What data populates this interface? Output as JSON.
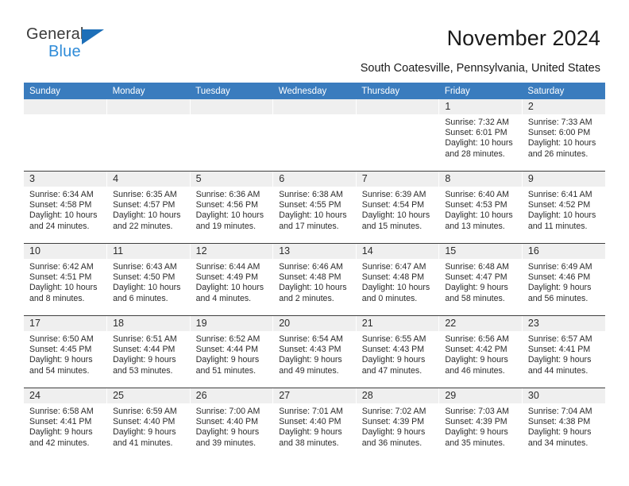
{
  "brand": {
    "name_part1": "General",
    "name_part2": "Blue",
    "logo_icon": "blue-triangle-icon",
    "accent_color": "#2e8bd8",
    "header_color": "#3a7cbe"
  },
  "header": {
    "title": "November 2024",
    "subtitle": "South Coatesville, Pennsylvania, United States"
  },
  "calendar": {
    "weekday_headers": [
      "Sunday",
      "Monday",
      "Tuesday",
      "Wednesday",
      "Thursday",
      "Friday",
      "Saturday"
    ],
    "labels": {
      "sunrise": "Sunrise:",
      "sunset": "Sunset:",
      "daylight": "Daylight:"
    },
    "weeks": [
      [
        {
          "day": "",
          "empty": true
        },
        {
          "day": "",
          "empty": true
        },
        {
          "day": "",
          "empty": true
        },
        {
          "day": "",
          "empty": true
        },
        {
          "day": "",
          "empty": true
        },
        {
          "day": "1",
          "sunrise": "Sunrise: 7:32 AM",
          "sunset": "Sunset: 6:01 PM",
          "daylight_line1": "Daylight: 10 hours",
          "daylight_line2": "and 28 minutes."
        },
        {
          "day": "2",
          "sunrise": "Sunrise: 7:33 AM",
          "sunset": "Sunset: 6:00 PM",
          "daylight_line1": "Daylight: 10 hours",
          "daylight_line2": "and 26 minutes."
        }
      ],
      [
        {
          "day": "3",
          "sunrise": "Sunrise: 6:34 AM",
          "sunset": "Sunset: 4:58 PM",
          "daylight_line1": "Daylight: 10 hours",
          "daylight_line2": "and 24 minutes."
        },
        {
          "day": "4",
          "sunrise": "Sunrise: 6:35 AM",
          "sunset": "Sunset: 4:57 PM",
          "daylight_line1": "Daylight: 10 hours",
          "daylight_line2": "and 22 minutes."
        },
        {
          "day": "5",
          "sunrise": "Sunrise: 6:36 AM",
          "sunset": "Sunset: 4:56 PM",
          "daylight_line1": "Daylight: 10 hours",
          "daylight_line2": "and 19 minutes."
        },
        {
          "day": "6",
          "sunrise": "Sunrise: 6:38 AM",
          "sunset": "Sunset: 4:55 PM",
          "daylight_line1": "Daylight: 10 hours",
          "daylight_line2": "and 17 minutes."
        },
        {
          "day": "7",
          "sunrise": "Sunrise: 6:39 AM",
          "sunset": "Sunset: 4:54 PM",
          "daylight_line1": "Daylight: 10 hours",
          "daylight_line2": "and 15 minutes."
        },
        {
          "day": "8",
          "sunrise": "Sunrise: 6:40 AM",
          "sunset": "Sunset: 4:53 PM",
          "daylight_line1": "Daylight: 10 hours",
          "daylight_line2": "and 13 minutes."
        },
        {
          "day": "9",
          "sunrise": "Sunrise: 6:41 AM",
          "sunset": "Sunset: 4:52 PM",
          "daylight_line1": "Daylight: 10 hours",
          "daylight_line2": "and 11 minutes."
        }
      ],
      [
        {
          "day": "10",
          "sunrise": "Sunrise: 6:42 AM",
          "sunset": "Sunset: 4:51 PM",
          "daylight_line1": "Daylight: 10 hours",
          "daylight_line2": "and 8 minutes."
        },
        {
          "day": "11",
          "sunrise": "Sunrise: 6:43 AM",
          "sunset": "Sunset: 4:50 PM",
          "daylight_line1": "Daylight: 10 hours",
          "daylight_line2": "and 6 minutes."
        },
        {
          "day": "12",
          "sunrise": "Sunrise: 6:44 AM",
          "sunset": "Sunset: 4:49 PM",
          "daylight_line1": "Daylight: 10 hours",
          "daylight_line2": "and 4 minutes."
        },
        {
          "day": "13",
          "sunrise": "Sunrise: 6:46 AM",
          "sunset": "Sunset: 4:48 PM",
          "daylight_line1": "Daylight: 10 hours",
          "daylight_line2": "and 2 minutes."
        },
        {
          "day": "14",
          "sunrise": "Sunrise: 6:47 AM",
          "sunset": "Sunset: 4:48 PM",
          "daylight_line1": "Daylight: 10 hours",
          "daylight_line2": "and 0 minutes."
        },
        {
          "day": "15",
          "sunrise": "Sunrise: 6:48 AM",
          "sunset": "Sunset: 4:47 PM",
          "daylight_line1": "Daylight: 9 hours",
          "daylight_line2": "and 58 minutes."
        },
        {
          "day": "16",
          "sunrise": "Sunrise: 6:49 AM",
          "sunset": "Sunset: 4:46 PM",
          "daylight_line1": "Daylight: 9 hours",
          "daylight_line2": "and 56 minutes."
        }
      ],
      [
        {
          "day": "17",
          "sunrise": "Sunrise: 6:50 AM",
          "sunset": "Sunset: 4:45 PM",
          "daylight_line1": "Daylight: 9 hours",
          "daylight_line2": "and 54 minutes."
        },
        {
          "day": "18",
          "sunrise": "Sunrise: 6:51 AM",
          "sunset": "Sunset: 4:44 PM",
          "daylight_line1": "Daylight: 9 hours",
          "daylight_line2": "and 53 minutes."
        },
        {
          "day": "19",
          "sunrise": "Sunrise: 6:52 AM",
          "sunset": "Sunset: 4:44 PM",
          "daylight_line1": "Daylight: 9 hours",
          "daylight_line2": "and 51 minutes."
        },
        {
          "day": "20",
          "sunrise": "Sunrise: 6:54 AM",
          "sunset": "Sunset: 4:43 PM",
          "daylight_line1": "Daylight: 9 hours",
          "daylight_line2": "and 49 minutes."
        },
        {
          "day": "21",
          "sunrise": "Sunrise: 6:55 AM",
          "sunset": "Sunset: 4:43 PM",
          "daylight_line1": "Daylight: 9 hours",
          "daylight_line2": "and 47 minutes."
        },
        {
          "day": "22",
          "sunrise": "Sunrise: 6:56 AM",
          "sunset": "Sunset: 4:42 PM",
          "daylight_line1": "Daylight: 9 hours",
          "daylight_line2": "and 46 minutes."
        },
        {
          "day": "23",
          "sunrise": "Sunrise: 6:57 AM",
          "sunset": "Sunset: 4:41 PM",
          "daylight_line1": "Daylight: 9 hours",
          "daylight_line2": "and 44 minutes."
        }
      ],
      [
        {
          "day": "24",
          "sunrise": "Sunrise: 6:58 AM",
          "sunset": "Sunset: 4:41 PM",
          "daylight_line1": "Daylight: 9 hours",
          "daylight_line2": "and 42 minutes."
        },
        {
          "day": "25",
          "sunrise": "Sunrise: 6:59 AM",
          "sunset": "Sunset: 4:40 PM",
          "daylight_line1": "Daylight: 9 hours",
          "daylight_line2": "and 41 minutes."
        },
        {
          "day": "26",
          "sunrise": "Sunrise: 7:00 AM",
          "sunset": "Sunset: 4:40 PM",
          "daylight_line1": "Daylight: 9 hours",
          "daylight_line2": "and 39 minutes."
        },
        {
          "day": "27",
          "sunrise": "Sunrise: 7:01 AM",
          "sunset": "Sunset: 4:40 PM",
          "daylight_line1": "Daylight: 9 hours",
          "daylight_line2": "and 38 minutes."
        },
        {
          "day": "28",
          "sunrise": "Sunrise: 7:02 AM",
          "sunset": "Sunset: 4:39 PM",
          "daylight_line1": "Daylight: 9 hours",
          "daylight_line2": "and 36 minutes."
        },
        {
          "day": "29",
          "sunrise": "Sunrise: 7:03 AM",
          "sunset": "Sunset: 4:39 PM",
          "daylight_line1": "Daylight: 9 hours",
          "daylight_line2": "and 35 minutes."
        },
        {
          "day": "30",
          "sunrise": "Sunrise: 7:04 AM",
          "sunset": "Sunset: 4:38 PM",
          "daylight_line1": "Daylight: 9 hours",
          "daylight_line2": "and 34 minutes."
        }
      ]
    ]
  }
}
